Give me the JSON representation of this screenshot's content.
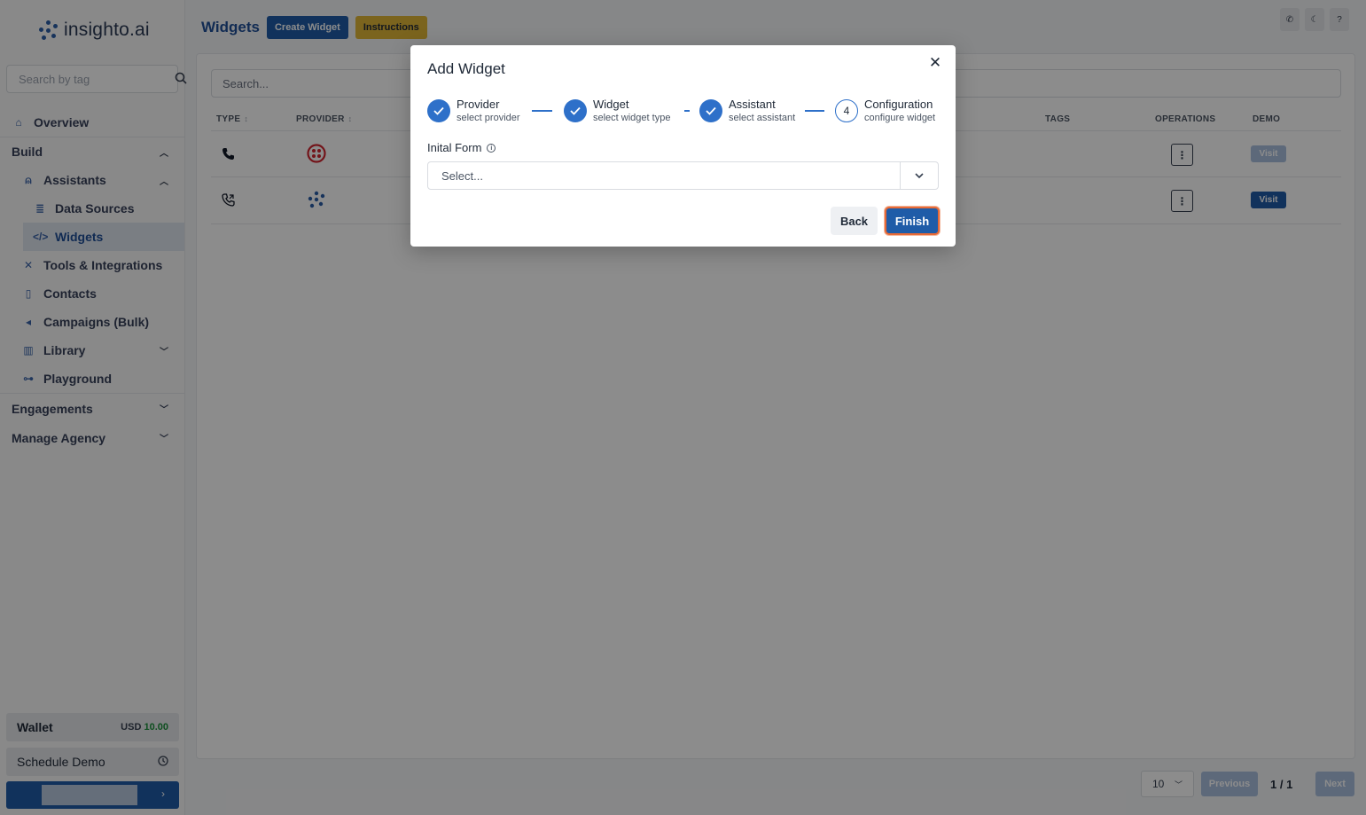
{
  "brand": {
    "name": "insighto.ai",
    "color": "#1f5ca8"
  },
  "sidebar": {
    "search_placeholder": "Search by tag",
    "items": [
      {
        "label": "Overview",
        "icon": "home-icon"
      },
      {
        "label": "Build",
        "icon": "chevron-up-icon"
      },
      {
        "label": "Assistants",
        "icon": "user-icon"
      },
      {
        "label": "Data Sources",
        "icon": "database-icon"
      },
      {
        "label": "Widgets",
        "icon": "code-icon",
        "active": true
      },
      {
        "label": "Tools & Integrations",
        "icon": "tools-icon"
      },
      {
        "label": "Contacts",
        "icon": "contacts-icon"
      },
      {
        "label": "Campaigns (Bulk)",
        "icon": "megaphone-icon"
      },
      {
        "label": "Library",
        "icon": "library-icon"
      },
      {
        "label": "Playground",
        "icon": "gamepad-icon"
      }
    ],
    "groups": {
      "engagements": "Engagements",
      "manage_agency": "Manage Agency"
    },
    "wallet": {
      "label": "Wallet",
      "currency": "USD",
      "amount": "10.00"
    },
    "schedule_demo": "Schedule Demo"
  },
  "header": {
    "title": "Widgets",
    "create_label": "Create Widget",
    "instructions_label": "Instructions"
  },
  "table": {
    "search_placeholder": "Search...",
    "columns": {
      "type": "TYPE",
      "provider": "PROVIDER",
      "tags": "TAGS",
      "operations": "OPERATIONS",
      "demo": "DEMO"
    },
    "rows": [
      {
        "type": "phone-icon",
        "provider": "twilio-icon",
        "demo_label": "Visit",
        "demo_enabled": false
      },
      {
        "type": "phone-forward-icon",
        "provider": "insighto-icon",
        "demo_label": "Visit",
        "demo_enabled": true
      }
    ]
  },
  "pagination": {
    "page_size": "10",
    "previous": "Previous",
    "page_info": "1 / 1",
    "next": "Next"
  },
  "modal": {
    "title": "Add Widget",
    "steps": [
      {
        "title": "Provider",
        "desc": "select provider",
        "done": true
      },
      {
        "title": "Widget",
        "desc": "select widget type",
        "done": true
      },
      {
        "title": "Assistant",
        "desc": "select assistant",
        "done": true
      },
      {
        "title": "Configuration",
        "desc": "configure widget",
        "done": false,
        "number": "4"
      }
    ],
    "field_label": "Inital Form",
    "select_placeholder": "Select...",
    "back_label": "Back",
    "finish_label": "Finish"
  }
}
